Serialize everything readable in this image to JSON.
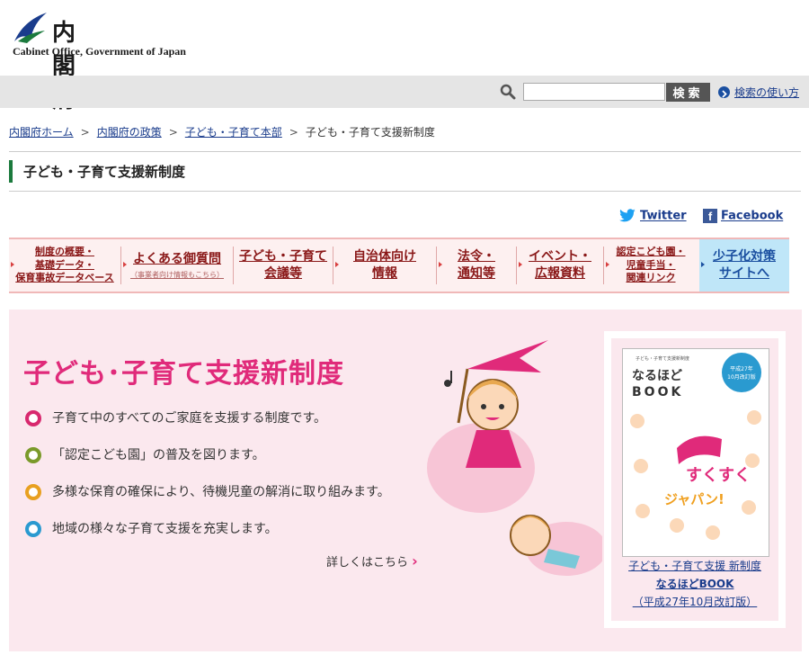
{
  "header": {
    "logo_title": "内閣府",
    "logo_sub": "Cabinet Office, Government of Japan"
  },
  "search": {
    "placeholder": "",
    "button_label": "検索",
    "howto_label": "検索の使い方"
  },
  "breadcrumb": {
    "items": [
      "内閣府ホーム",
      "内閣府の政策",
      "子ども・子育て本部"
    ],
    "current": "子ども・子育て支援新制度",
    "separator": ">"
  },
  "page_title": "子ども・子育て支援新制度",
  "social": {
    "twitter": "Twitter",
    "facebook": "Facebook"
  },
  "menu": {
    "items": [
      {
        "lines": [
          "制度の概要・",
          "基礎データ・",
          "保育事故データベース"
        ]
      },
      {
        "lines": [
          "よくある御質問"
        ],
        "sub": "（事業者向け情報もこちら）"
      },
      {
        "lines": [
          "子ども・子育て",
          "会議等"
        ]
      },
      {
        "lines": [
          "自治体向け",
          "情報"
        ]
      },
      {
        "lines": [
          "法令・",
          "通知等"
        ]
      },
      {
        "lines": [
          "イベント・",
          "広報資料"
        ]
      },
      {
        "lines": [
          "認定こども園・",
          "児童手当・",
          "関連リンク"
        ]
      },
      {
        "lines": [
          "少子化対策",
          "サイトへ"
        ]
      }
    ]
  },
  "hero": {
    "title": "子ども･子育て支援新制度",
    "bullets": [
      {
        "text": "子育て中のすべてのご家庭を支援する制度です。",
        "color": "#d8286e"
      },
      {
        "text": "「認定こども園」の普及を図ります。",
        "color": "#7a9a2a"
      },
      {
        "text": "多様な保育の確保により、待機児童の解消に取り組みます。",
        "color": "#e8a020"
      },
      {
        "text": "地域の様々な子育て支援を充実します。",
        "color": "#2a9ad0"
      }
    ],
    "more": "詳しくはこちら"
  },
  "book": {
    "cover_title_small": "子ども・子育て支援新制度",
    "cover_title": "なるほど",
    "cover_title2": "BOOK",
    "cover_badge1": "平成27年",
    "cover_badge2": "10月改訂版",
    "cover_main": "すくすくジャパン！",
    "caption1": "子ども・子育て支援 新制度",
    "caption2": "なるほどBOOK",
    "caption3": "（平成27年10月改訂版）"
  },
  "colors": {
    "accent_pink": "#e02a7a",
    "menu_text": "#8a1818",
    "link": "#1a3c8c",
    "title_bar": "#1b7a3d"
  }
}
